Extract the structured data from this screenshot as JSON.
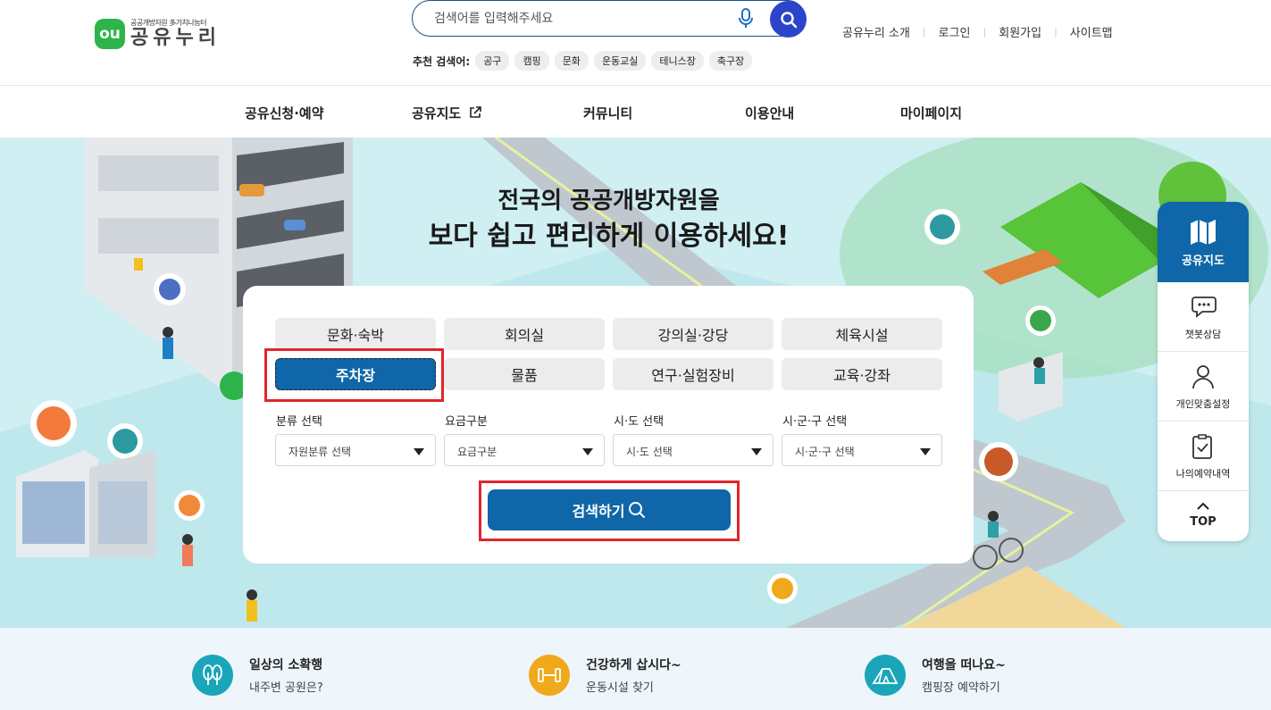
{
  "header": {
    "logo_sub": "공공개방자원 多가치나눔터",
    "logo_main": "공유누리",
    "logo_mark": "ou",
    "search_placeholder": "검색어를 입력해주세요",
    "recommend_label": "추천 검색어:",
    "recommend_tags": [
      "공구",
      "캠핑",
      "문화",
      "운동교실",
      "테니스장",
      "축구장"
    ],
    "top_links": [
      "공유누리 소개",
      "로그인",
      "회원가입",
      "사이트맵"
    ]
  },
  "nav": {
    "items": [
      "공유신청·예약",
      "공유지도",
      "커뮤니티",
      "이용안내",
      "마이페이지"
    ]
  },
  "hero": {
    "title_line1": "전국의 공공개방자원을",
    "title_line2": "보다 쉽고 편리하게 이용하세요!"
  },
  "search_panel": {
    "categories": [
      "문화·숙박",
      "회의실",
      "강의실·강당",
      "체육시설",
      "주차장",
      "물품",
      "연구·실험장비",
      "교육·강좌"
    ],
    "active_category": "주차장",
    "selects": [
      {
        "label": "분류 선택",
        "value": "자원분류 선택"
      },
      {
        "label": "요금구분",
        "value": "요금구분"
      },
      {
        "label": "시·도 선택",
        "value": "시·도 선택"
      },
      {
        "label": "시·군·구 선택",
        "value": "시·군·구 선택"
      }
    ],
    "search_button": "검색하기"
  },
  "side_float": {
    "map_label": "공유지도",
    "chatbot_label": "챗봇상담",
    "custom_label": "개인맞춤설정",
    "reservation_label": "나의예약내역",
    "top_label": "TOP"
  },
  "bottom_links": [
    {
      "title": "일상의 소확행",
      "sub": "내주변 공원은?",
      "icon": "park-icon",
      "color": "#1aa5b8"
    },
    {
      "title": "건강하게 삽시다~",
      "sub": "운동시설 찾기",
      "icon": "dumbbell-icon",
      "color": "#f0a81c"
    },
    {
      "title": "여행을 떠나요~",
      "sub": "캠핑장 예약하기",
      "icon": "tent-icon",
      "color": "#1aa5b8"
    }
  ],
  "colors": {
    "brand_blue": "#0f66a8",
    "search_blue": "#2b44c9",
    "highlight_red": "#e0262c",
    "logo_green": "#2db54b",
    "hero_bg": "#cfeff2"
  }
}
